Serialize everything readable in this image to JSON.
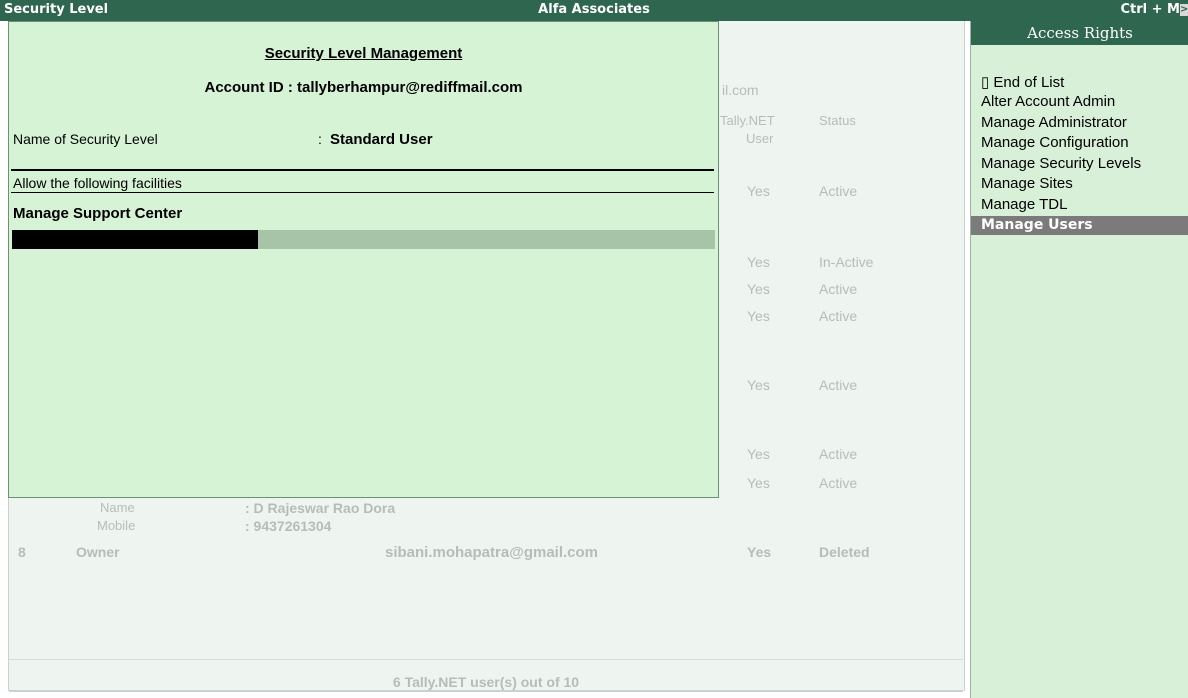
{
  "titlebar": {
    "left": "Security Level",
    "center": "Alfa Associates",
    "right": "Ctrl + M",
    "arrow": ">"
  },
  "background": {
    "email_fragment": "il.com",
    "col_tally_net_user": "Tally.NET",
    "col_tally_net_user_2": "User",
    "col_status": "Status",
    "rows": [
      {
        "tally": "Yes",
        "status": "Active"
      },
      {
        "tally": "Yes",
        "status": "In-Active"
      },
      {
        "tally": "Yes",
        "status": "Active"
      },
      {
        "tally": "Yes",
        "status": "Active"
      },
      {
        "tally": "Yes",
        "status": "Active"
      },
      {
        "tally": "Yes",
        "status": "Active"
      },
      {
        "tally": "Yes",
        "status": "Active"
      }
    ],
    "detail_name_label": "Name",
    "detail_name_value": ": D Rajeswar Rao Dora",
    "detail_mobile_label": "Mobile",
    "detail_mobile_value": ": 9437261304",
    "row8": {
      "num": "8",
      "role": "Owner",
      "email": "sibani.mohapatra@gmail.com",
      "tally": "Yes",
      "status": "Deleted"
    },
    "footer": "6 Tally.NET user(s) out of 10"
  },
  "dialog": {
    "title": "Security Level Management",
    "account": "Account ID : tallyberhampur@rediffmail.com",
    "name_label": "Name of Security Level",
    "name_colon": ":",
    "name_value": "Standard User",
    "allow_label": "Allow the following facilities",
    "facility": "Manage Support Center",
    "input_bar_filled_fraction": 0.35
  },
  "access_rights": {
    "header": "Access Rights",
    "items": [
      "▯ End of List",
      "Alter Account  Admin",
      "Manage Administrator",
      "Manage Configuration",
      "Manage Security Levels",
      "Manage Sites",
      "Manage TDL",
      "Manage Users"
    ]
  }
}
